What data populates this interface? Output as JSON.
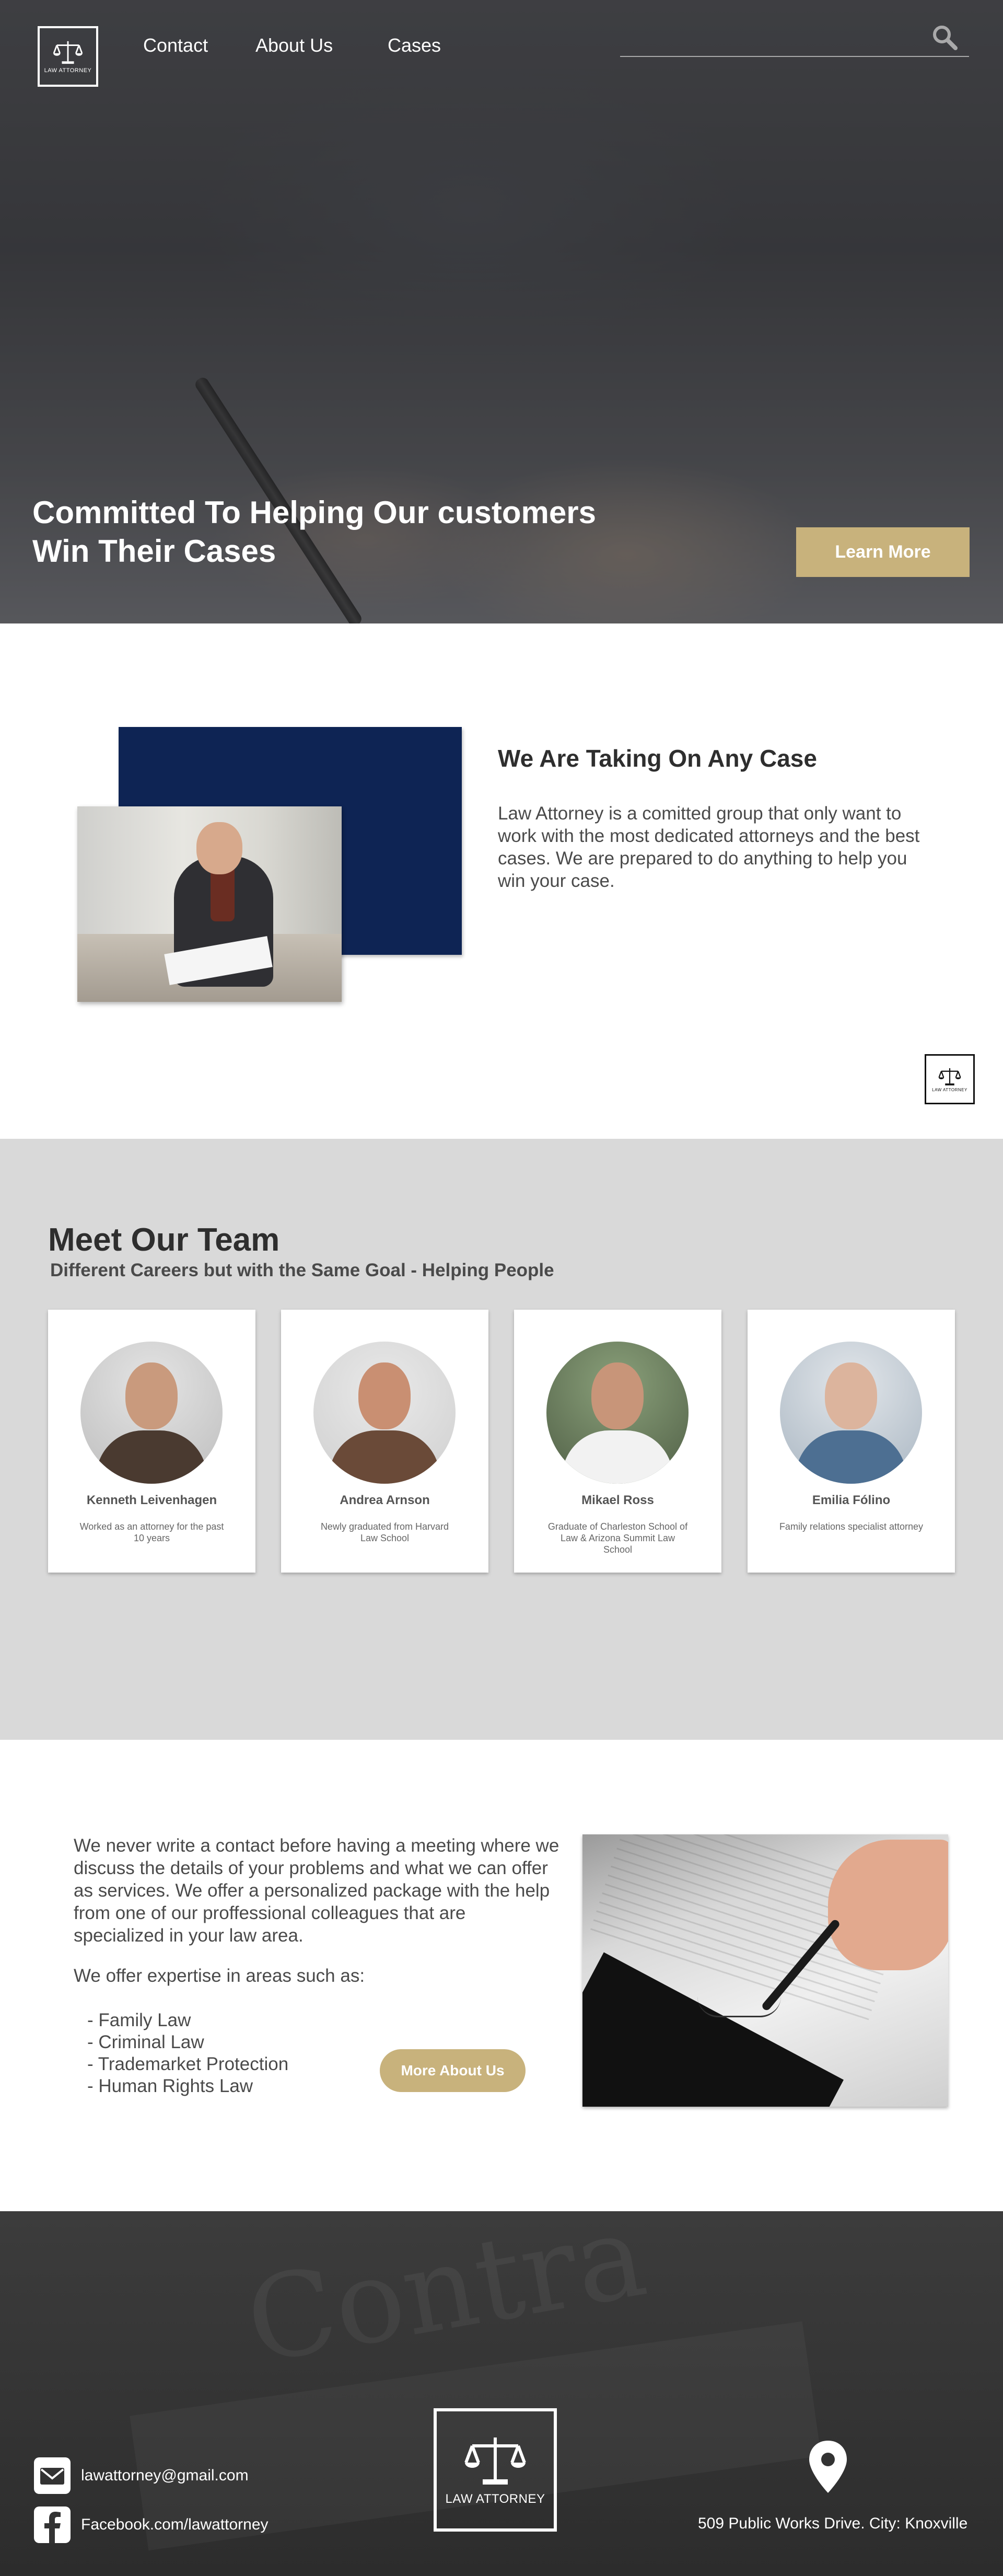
{
  "brand": {
    "logo_caption": "LAW ATTORNEY"
  },
  "nav": {
    "items": [
      "Contact",
      "About Us",
      "Cases"
    ]
  },
  "search": {
    "icon": "search-icon"
  },
  "hero": {
    "title": "Committed To Helping Our customers Win Their Cases",
    "button": "Learn More"
  },
  "about": {
    "title": "We Are Taking On Any Case",
    "text": "Law Attorney is a comitted group that only want to work with the most dedicated attorneys and the best cases. We are prepared to do anything to help you win your case."
  },
  "team": {
    "title": "Meet Our Team",
    "subtitle": "Different Careers but with the Same Goal - Helping People",
    "members": [
      {
        "name": "Kenneth Leivenhagen",
        "desc": "Worked as an attorney for the past 10 years"
      },
      {
        "name": "Andrea Arnson",
        "desc": "Newly graduated from Harvard Law School"
      },
      {
        "name": "Mikael Ross",
        "desc": "Graduate of Charleston School of Law & Arizona Summit Law School"
      },
      {
        "name": "Emilia Fólino",
        "desc": "Family relations specialist attorney"
      }
    ]
  },
  "services": {
    "text": "We never write a contact before having a meeting where we discuss the details of your problems and what we can offer as services. We offer a personalized package with the help from one of our proffessional colleagues that are specialized in your law area.",
    "expertise_intro": "We offer expertise in areas such as:",
    "areas": [
      "- Family Law",
      "- Criminal Law",
      "- Trademarket Protection",
      "- Human Rights Law"
    ],
    "button": "More About Us"
  },
  "footer": {
    "email": "lawattorney@gmail.com",
    "facebook": "Facebook.com/lawattorney",
    "address": "509 Public Works Drive. City: Knoxville"
  },
  "colors": {
    "accent": "#c8b27c",
    "navy": "#0e2454",
    "team_bg": "#d9d9d9",
    "footer_bg": "#333333"
  }
}
